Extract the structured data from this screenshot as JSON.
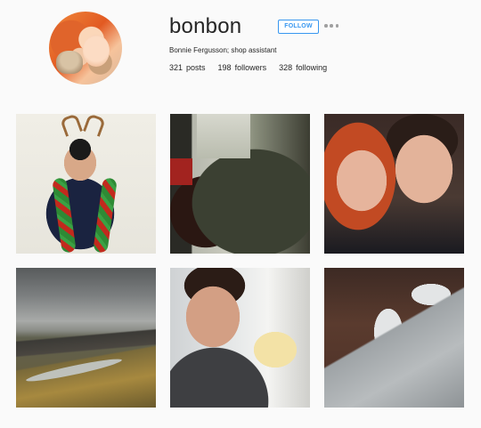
{
  "profile": {
    "username": "bonbon",
    "follow_label": "FOLLOW",
    "bio": "Bonnie Fergusson; shop assistant",
    "avatar_icon": "profile-avatar"
  },
  "stats": [
    {
      "count": "321",
      "label": "posts"
    },
    {
      "count": "198",
      "label": "followers"
    },
    {
      "count": "328",
      "label": "following"
    }
  ],
  "icons": {
    "options": "more-options-icon"
  },
  "colors": {
    "accent": "#3897f0",
    "background": "#fafafa",
    "text": "#262626"
  },
  "posts": [
    {
      "subject": "man with reindeer antlers and festive boa"
    },
    {
      "subject": "two people embracing near window"
    },
    {
      "subject": "couple selfie, red-haired woman and man"
    },
    {
      "subject": "mountain valley with river"
    },
    {
      "subject": "man holding a duckling"
    },
    {
      "subject": "feet in grey sneakers"
    }
  ]
}
